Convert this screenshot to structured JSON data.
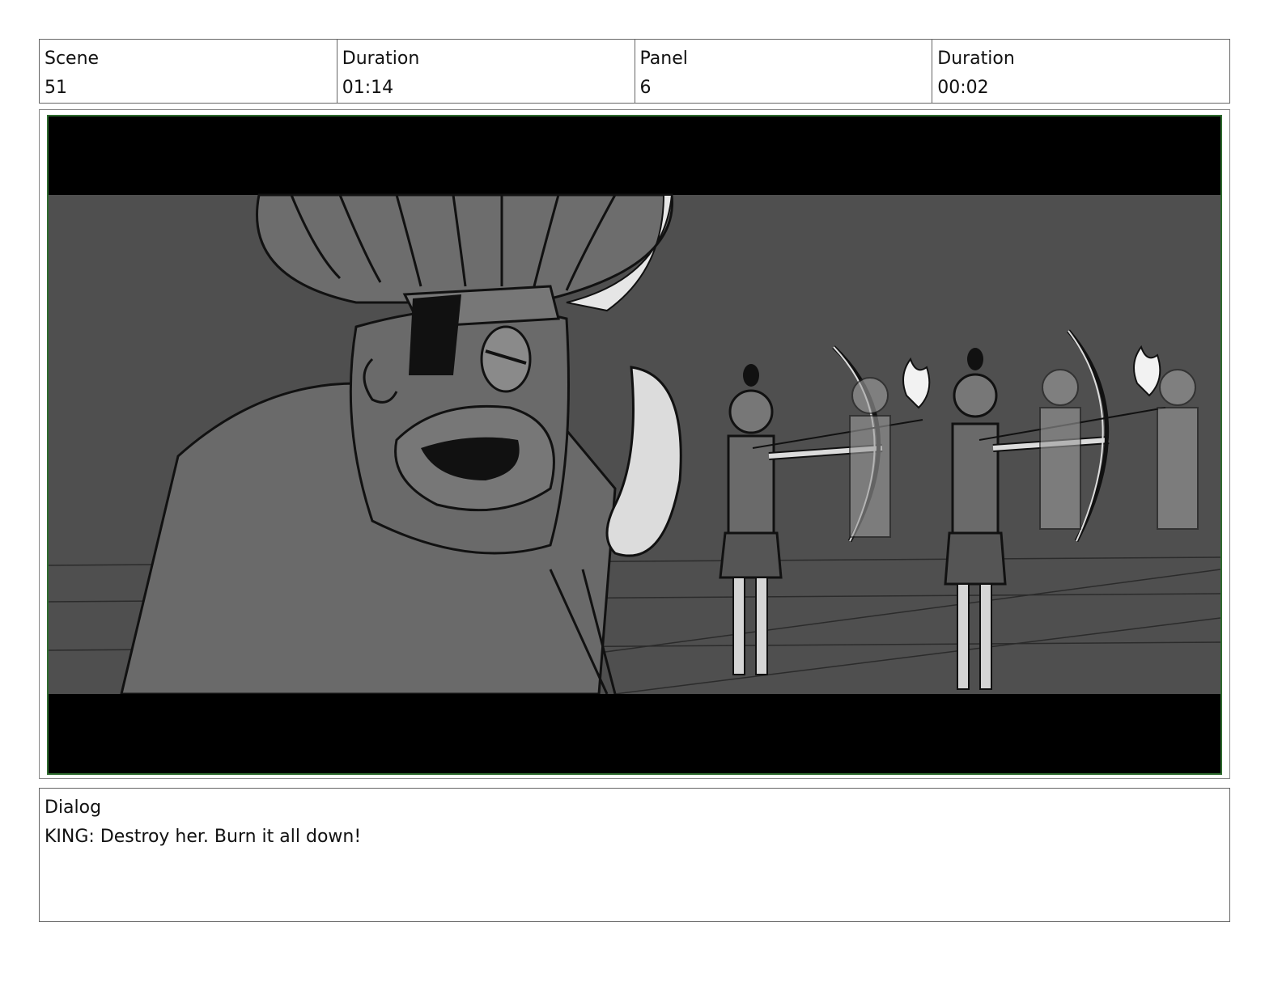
{
  "header": {
    "cells": [
      {
        "label": "Scene",
        "value": "51"
      },
      {
        "label": "Duration",
        "value": "01:14"
      },
      {
        "label": "Panel",
        "value": "6"
      },
      {
        "label": "Duration",
        "value": "00:02"
      }
    ]
  },
  "panel": {
    "colors": {
      "frame_border": "#2e6b2e",
      "letterbox": "#000000",
      "background": "#4f4f4f"
    }
  },
  "dialog": {
    "label": "Dialog",
    "text": "KING: Destroy her. Burn it all down!"
  }
}
